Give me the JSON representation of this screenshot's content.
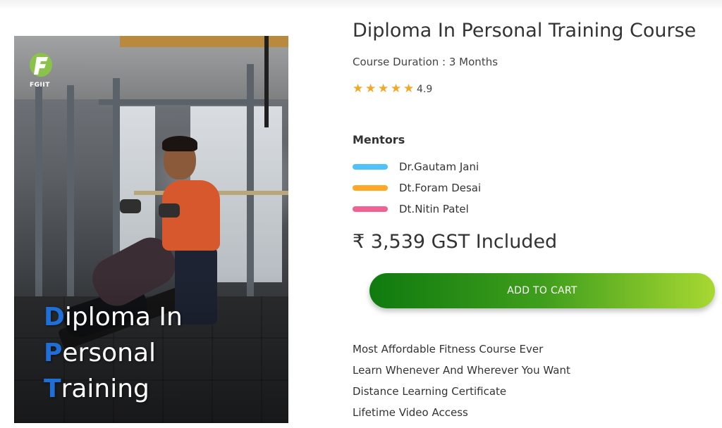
{
  "course": {
    "title": "Diploma In Personal Training Course",
    "duration": "Course Duration : 3 Months",
    "rating": {
      "stars": 5,
      "value": "4.9",
      "star_icon": "star-icon",
      "star_color": "#f5a623"
    },
    "price": "₹ 3,539 GST Included"
  },
  "image": {
    "logo_text": "FGIIT",
    "title_lines": [
      {
        "initial": "D",
        "rest": "iploma In"
      },
      {
        "initial": "P",
        "rest": "ersonal"
      },
      {
        "initial": "T",
        "rest": "raining"
      }
    ],
    "initial_color": "#1f6fd8"
  },
  "mentors": {
    "heading": "Mentors",
    "items": [
      {
        "name": "Dr.Gautam Jani",
        "color": "#4fc3f7"
      },
      {
        "name": "Dt.Foram Desai",
        "color": "#ffa726"
      },
      {
        "name": "Dt.Nitin Patel",
        "color": "#f06292"
      }
    ]
  },
  "cart": {
    "label": "ADD TO CART"
  },
  "features": [
    "Most Affordable Fitness Course Ever",
    "Learn Whenever And Wherever You Want",
    "Distance Learning Certificate",
    "Lifetime Video Access"
  ]
}
